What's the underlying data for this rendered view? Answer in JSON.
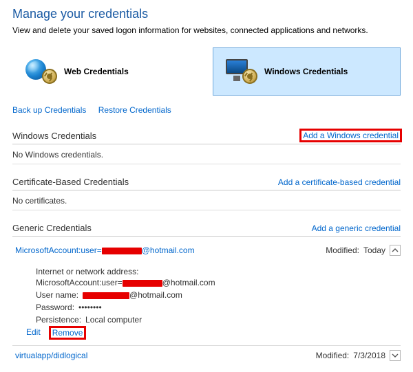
{
  "header": {
    "title": "Manage your credentials",
    "subtitle": "View and delete your saved logon information for websites, connected applications and networks."
  },
  "tiles": {
    "web": "Web Credentials",
    "windows": "Windows Credentials"
  },
  "links": {
    "backup": "Back up Credentials",
    "restore": "Restore Credentials"
  },
  "sections": {
    "windows": {
      "heading": "Windows Credentials",
      "add": "Add a Windows credential",
      "empty": "No Windows credentials."
    },
    "cert": {
      "heading": "Certificate-Based Credentials",
      "add": "Add a certificate-based credential",
      "empty": "No certificates."
    },
    "generic": {
      "heading": "Generic Credentials",
      "add": "Add a generic credential"
    }
  },
  "modified_label": "Modified:",
  "entries": {
    "msa": {
      "name_prefix": "MicrosoftAccount:user=",
      "name_suffix": "@hotmail.com",
      "modified": "Today",
      "details": {
        "addr_label": "Internet or network address:",
        "addr_prefix": "MicrosoftAccount:user=",
        "addr_suffix": "@hotmail.com",
        "user_label": "User name:",
        "user_suffix": "@hotmail.com",
        "pass_label": "Password:",
        "pass_value": "••••••••",
        "persist_label": "Persistence:",
        "persist_value": "Local computer"
      },
      "actions": {
        "edit": "Edit",
        "remove": "Remove"
      }
    },
    "virtualapp": {
      "name": "virtualapp/didlogical",
      "modified": "7/3/2018"
    }
  }
}
